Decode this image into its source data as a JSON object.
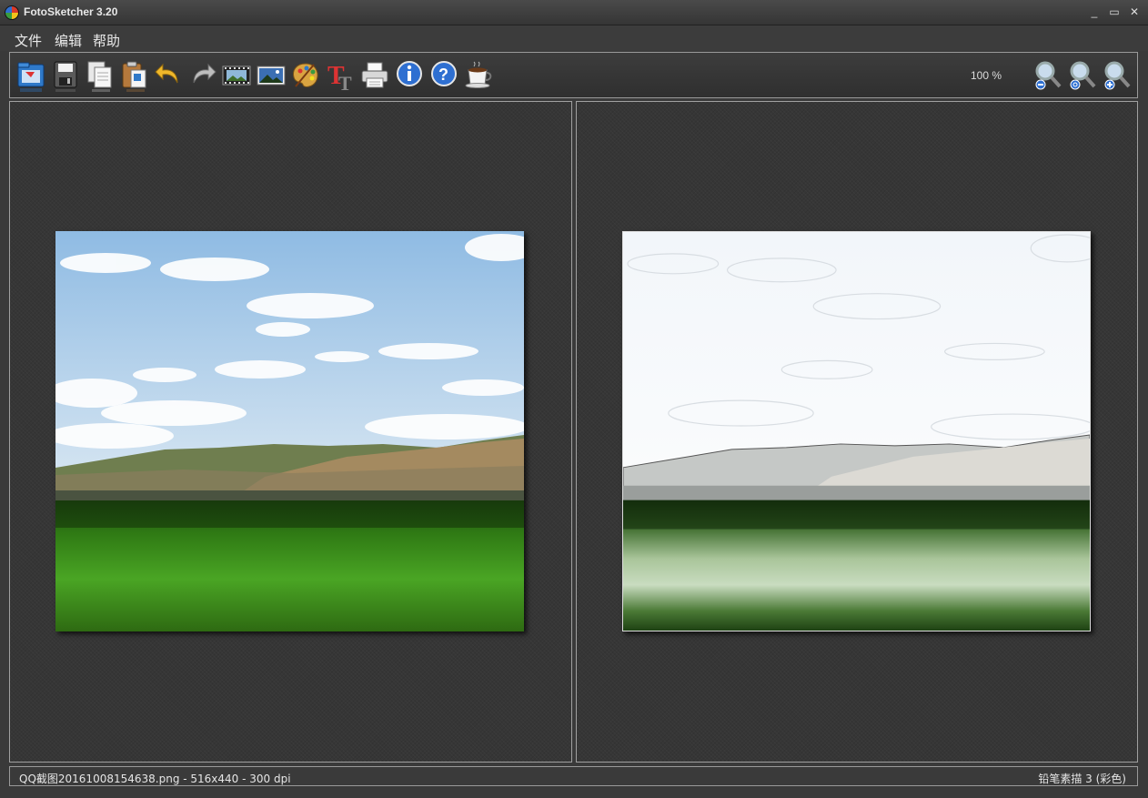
{
  "window": {
    "title": "FotoSketcher 3.20",
    "minimize_glyph": "_",
    "maximize_glyph": "▭",
    "close_glyph": "✕"
  },
  "menu": {
    "items": [
      {
        "label": "文件"
      },
      {
        "label": "编辑"
      },
      {
        "label": "帮助"
      }
    ]
  },
  "toolbar": {
    "buttons": [
      {
        "icon": "open-folder-icon"
      },
      {
        "icon": "save-disk-icon"
      },
      {
        "icon": "copy-icon"
      },
      {
        "icon": "paste-icon"
      },
      {
        "icon": "undo-arrow-icon"
      },
      {
        "icon": "redo-arrow-icon"
      },
      {
        "icon": "filmstrip-icon"
      },
      {
        "icon": "picture-icon"
      },
      {
        "icon": "palette-icon"
      },
      {
        "icon": "text-tool-icon"
      },
      {
        "icon": "printer-icon"
      },
      {
        "icon": "info-icon"
      },
      {
        "icon": "help-icon"
      },
      {
        "icon": "coffee-cup-icon"
      }
    ],
    "zoom_level": "100 %",
    "zoom_buttons": [
      {
        "icon": "zoom-out-icon"
      },
      {
        "icon": "zoom-reset-icon"
      },
      {
        "icon": "zoom-in-icon"
      }
    ]
  },
  "status": {
    "file_info": "QQ截图20161008154638.png - 516x440 - 300 dpi",
    "effect": "铅笔素描 3 (彩色)"
  },
  "colors": {
    "accent_blue": "#2e6fd1",
    "sky": "#a9cbe8",
    "grass": "#3f8f1c"
  }
}
